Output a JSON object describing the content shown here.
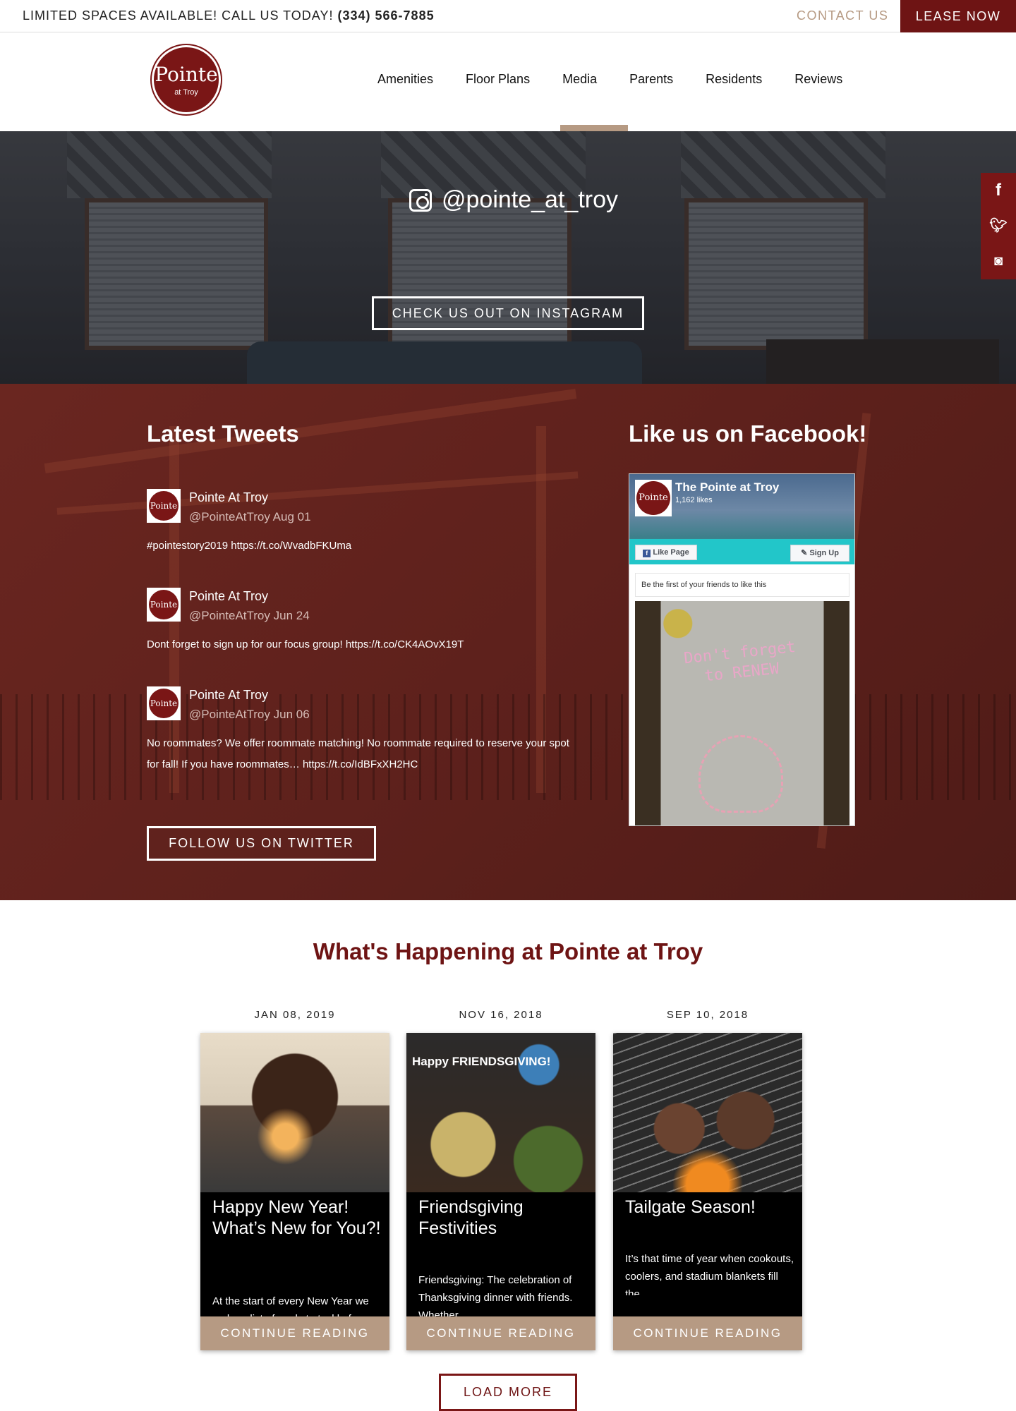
{
  "topbar": {
    "promo": "LIMITED SPACES AVAILABLE! CALL US TODAY!",
    "phone": "(334) 566-7885",
    "contact": "CONTACT US",
    "lease": "LEASE NOW"
  },
  "logo": {
    "line1": "Pointe",
    "line2": "at Troy"
  },
  "nav": [
    "Amenities",
    "Floor Plans",
    "Media",
    "Parents",
    "Residents",
    "Reviews"
  ],
  "instagram": {
    "handle": "@pointe_at_troy",
    "button": "CHECK US OUT ON INSTAGRAM"
  },
  "social": {
    "facebook": "f",
    "twitter": "t",
    "instagram": "ig"
  },
  "tweets_section": {
    "title": "Latest Tweets",
    "items": [
      {
        "name": "Pointe At Troy",
        "handle": "@PointeAtTroy Aug 01",
        "text_prefix": "",
        "hashtag": "#pointestory2019",
        "link": "https://t.co/WvadbFKUma"
      },
      {
        "name": "Pointe At Troy",
        "handle": "@PointeAtTroy Jun 24",
        "text_prefix": "Dont forget to sign up for our focus group!",
        "link": "https://t.co/CK4AOvX19T"
      },
      {
        "name": "Pointe At Troy",
        "handle": "@PointeAtTroy Jun 06",
        "text_prefix": "No roommates? We offer roommate matching! No roommate required to reserve your spot for fall! If you have roommates…",
        "link": "https://t.co/IdBFxXH2HC"
      }
    ],
    "follow_button": "FOLLOW US ON TWITTER",
    "avatar_text": "Pointe"
  },
  "facebook_section": {
    "title": "Like us on Facebook!",
    "page_name": "The Pointe at Troy",
    "likes": "1,162 likes",
    "like_button": "Like Page",
    "signup_button": "Sign Up",
    "friends_text": "Be the first of your friends to like this",
    "chalk_text": "Don't forget to RENEW"
  },
  "happening": {
    "title": "What's Happening at Pointe at Troy",
    "posts": [
      {
        "date": "JAN 08, 2019",
        "title": "Happy New Year! What’s New for You?!",
        "excerpt": " At the start of every New Year we make a list of goals to tackle for the...",
        "cta": "CONTINUE READING"
      },
      {
        "date": "NOV 16, 2018",
        "title": "Friendsgiving Festivities",
        "excerpt": "Friendsgiving: The celebration of Thanksgiving dinner with friends. Whether...",
        "cta": "CONTINUE READING",
        "image_text": "Happy FRIENDSGIVING!"
      },
      {
        "date": "SEP 10, 2018",
        "title": "Tailgate Season!",
        "excerpt": "It’s that time of year when cookouts, coolers, and stadium blankets fill the...",
        "cta": "CONTINUE READING"
      }
    ],
    "load_more": "LOAD MORE"
  }
}
